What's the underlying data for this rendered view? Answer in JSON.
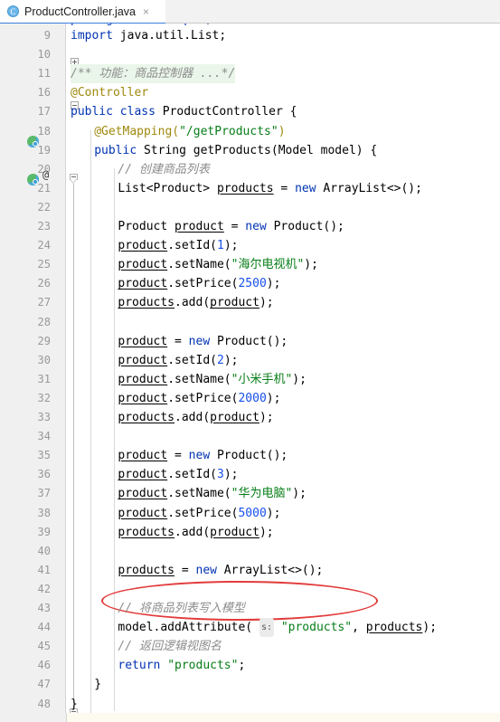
{
  "window": {
    "tab": {
      "icon": "java-class-icon",
      "title": "ProductController.java",
      "close": "×"
    }
  },
  "editor": {
    "language": "Java",
    "gutter_marks": {
      "spring_bean_icon": "spring-bean-icon",
      "override_at": "@"
    },
    "inlay_hint": "s:",
    "annotation": {
      "shape": "ellipse",
      "color": "#e23b3b",
      "target_line": 41
    },
    "colors": {
      "keyword": "#0033b3",
      "string": "#067d17",
      "number": "#1750eb",
      "annotation": "#9e880d",
      "comment": "#8c8c8c",
      "folded_background": "#eaf6e9",
      "gutter_background": "#f0f0f0",
      "tab_accent": "#3c7ddb"
    },
    "lines": [
      {
        "n": "9",
        "indent": 0,
        "tokens": [
          {
            "t": "kw",
            "v": "import"
          },
          {
            "t": "plain",
            "v": " java.util.List;"
          }
        ]
      },
      {
        "n": "10",
        "indent": 0,
        "tokens": []
      },
      {
        "n": "11",
        "indent": 0,
        "folded": true,
        "tokens": [
          {
            "t": "fld",
            "v": "/** 功能：商品控制器 ...*/"
          }
        ]
      },
      {
        "n": "16",
        "indent": 0,
        "tokens": [
          {
            "t": "ann",
            "v": "@Controller"
          }
        ]
      },
      {
        "n": "17",
        "indent": 0,
        "tokens": [
          {
            "t": "kw",
            "v": "public class"
          },
          {
            "t": "plain",
            "v": " ProductController {"
          }
        ]
      },
      {
        "n": "18",
        "indent": 1,
        "tokens": [
          {
            "t": "ann",
            "v": "@GetMapping("
          },
          {
            "t": "str",
            "v": "\"/getProducts\""
          },
          {
            "t": "ann",
            "v": ")"
          }
        ]
      },
      {
        "n": "19",
        "indent": 1,
        "tokens": [
          {
            "t": "kw",
            "v": "public"
          },
          {
            "t": "plain",
            "v": " String getProducts(Model model) {"
          }
        ]
      },
      {
        "n": "20",
        "indent": 2,
        "tokens": [
          {
            "t": "cmt",
            "v": "// 创建商品列表"
          }
        ]
      },
      {
        "n": "21",
        "indent": 2,
        "tokens": [
          {
            "t": "plain",
            "v": "List<Product> "
          },
          {
            "t": "fieldu",
            "v": "products"
          },
          {
            "t": "plain",
            "v": " = "
          },
          {
            "t": "kw",
            "v": "new"
          },
          {
            "t": "plain",
            "v": " ArrayList<>();"
          }
        ]
      },
      {
        "n": "22",
        "indent": 2,
        "tokens": []
      },
      {
        "n": "23",
        "indent": 2,
        "tokens": [
          {
            "t": "plain",
            "v": "Product "
          },
          {
            "t": "fieldu",
            "v": "product"
          },
          {
            "t": "plain",
            "v": " = "
          },
          {
            "t": "kw",
            "v": "new"
          },
          {
            "t": "plain",
            "v": " Product();"
          }
        ]
      },
      {
        "n": "24",
        "indent": 2,
        "tokens": [
          {
            "t": "fieldu",
            "v": "product"
          },
          {
            "t": "plain",
            "v": ".setId("
          },
          {
            "t": "num",
            "v": "1"
          },
          {
            "t": "plain",
            "v": ");"
          }
        ]
      },
      {
        "n": "25",
        "indent": 2,
        "tokens": [
          {
            "t": "fieldu",
            "v": "product"
          },
          {
            "t": "plain",
            "v": ".setName("
          },
          {
            "t": "str",
            "v": "\"海尔电视机\""
          },
          {
            "t": "plain",
            "v": ");"
          }
        ]
      },
      {
        "n": "26",
        "indent": 2,
        "tokens": [
          {
            "t": "fieldu",
            "v": "product"
          },
          {
            "t": "plain",
            "v": ".setPrice("
          },
          {
            "t": "num",
            "v": "2500"
          },
          {
            "t": "plain",
            "v": ");"
          }
        ]
      },
      {
        "n": "27",
        "indent": 2,
        "tokens": [
          {
            "t": "fieldu",
            "v": "products"
          },
          {
            "t": "plain",
            "v": ".add("
          },
          {
            "t": "fieldu",
            "v": "product"
          },
          {
            "t": "plain",
            "v": ");"
          }
        ]
      },
      {
        "n": "28",
        "indent": 2,
        "tokens": []
      },
      {
        "n": "29",
        "indent": 2,
        "tokens": [
          {
            "t": "fieldu",
            "v": "product"
          },
          {
            "t": "plain",
            "v": " = "
          },
          {
            "t": "kw",
            "v": "new"
          },
          {
            "t": "plain",
            "v": " Product();"
          }
        ]
      },
      {
        "n": "30",
        "indent": 2,
        "tokens": [
          {
            "t": "fieldu",
            "v": "product"
          },
          {
            "t": "plain",
            "v": ".setId("
          },
          {
            "t": "num",
            "v": "2"
          },
          {
            "t": "plain",
            "v": ");"
          }
        ]
      },
      {
        "n": "31",
        "indent": 2,
        "tokens": [
          {
            "t": "fieldu",
            "v": "product"
          },
          {
            "t": "plain",
            "v": ".setName("
          },
          {
            "t": "str",
            "v": "\"小米手机\""
          },
          {
            "t": "plain",
            "v": ");"
          }
        ]
      },
      {
        "n": "32",
        "indent": 2,
        "tokens": [
          {
            "t": "fieldu",
            "v": "product"
          },
          {
            "t": "plain",
            "v": ".setPrice("
          },
          {
            "t": "num",
            "v": "2000"
          },
          {
            "t": "plain",
            "v": ");"
          }
        ]
      },
      {
        "n": "33",
        "indent": 2,
        "tokens": [
          {
            "t": "fieldu",
            "v": "products"
          },
          {
            "t": "plain",
            "v": ".add("
          },
          {
            "t": "fieldu",
            "v": "product"
          },
          {
            "t": "plain",
            "v": ");"
          }
        ]
      },
      {
        "n": "34",
        "indent": 2,
        "tokens": []
      },
      {
        "n": "35",
        "indent": 2,
        "tokens": [
          {
            "t": "fieldu",
            "v": "product"
          },
          {
            "t": "plain",
            "v": " = "
          },
          {
            "t": "kw",
            "v": "new"
          },
          {
            "t": "plain",
            "v": " Product();"
          }
        ]
      },
      {
        "n": "36",
        "indent": 2,
        "tokens": [
          {
            "t": "fieldu",
            "v": "product"
          },
          {
            "t": "plain",
            "v": ".setId("
          },
          {
            "t": "num",
            "v": "3"
          },
          {
            "t": "plain",
            "v": ");"
          }
        ]
      },
      {
        "n": "37",
        "indent": 2,
        "tokens": [
          {
            "t": "fieldu",
            "v": "product"
          },
          {
            "t": "plain",
            "v": ".setName("
          },
          {
            "t": "str",
            "v": "\"华为电脑\""
          },
          {
            "t": "plain",
            "v": ");"
          }
        ]
      },
      {
        "n": "38",
        "indent": 2,
        "tokens": [
          {
            "t": "fieldu",
            "v": "product"
          },
          {
            "t": "plain",
            "v": ".setPrice("
          },
          {
            "t": "num",
            "v": "5000"
          },
          {
            "t": "plain",
            "v": ");"
          }
        ]
      },
      {
        "n": "39",
        "indent": 2,
        "tokens": [
          {
            "t": "fieldu",
            "v": "products"
          },
          {
            "t": "plain",
            "v": ".add("
          },
          {
            "t": "fieldu",
            "v": "product"
          },
          {
            "t": "plain",
            "v": ");"
          }
        ]
      },
      {
        "n": "40",
        "indent": 2,
        "tokens": []
      },
      {
        "n": "41",
        "indent": 2,
        "tokens": [
          {
            "t": "fieldu",
            "v": "products"
          },
          {
            "t": "plain",
            "v": " = "
          },
          {
            "t": "kw",
            "v": "new"
          },
          {
            "t": "plain",
            "v": " ArrayList<>();"
          }
        ]
      },
      {
        "n": "42",
        "indent": 2,
        "tokens": []
      },
      {
        "n": "43",
        "indent": 2,
        "tokens": [
          {
            "t": "cmt",
            "v": "// 将商品列表写入模型"
          }
        ]
      },
      {
        "n": "44",
        "indent": 2,
        "tokens": [
          {
            "t": "plain",
            "v": "model.addAttribute( "
          },
          {
            "t": "hint",
            "v": "s:"
          },
          {
            "t": "plain",
            "v": " "
          },
          {
            "t": "str",
            "v": "\"products\""
          },
          {
            "t": "plain",
            "v": ", "
          },
          {
            "t": "fieldu",
            "v": "products"
          },
          {
            "t": "plain",
            "v": ");"
          }
        ]
      },
      {
        "n": "45",
        "indent": 2,
        "tokens": [
          {
            "t": "cmt",
            "v": "// 返回逻辑视图名"
          }
        ]
      },
      {
        "n": "46",
        "indent": 2,
        "tokens": [
          {
            "t": "kw",
            "v": "return"
          },
          {
            "t": "plain",
            "v": " "
          },
          {
            "t": "str",
            "v": "\"products\""
          },
          {
            "t": "plain",
            "v": ";"
          }
        ]
      },
      {
        "n": "47",
        "indent": 1,
        "tokens": [
          {
            "t": "plain",
            "v": "}"
          }
        ]
      },
      {
        "n": "48",
        "indent": 0,
        "tokens": [
          {
            "t": "plain",
            "v": "}"
          }
        ]
      }
    ]
  }
}
